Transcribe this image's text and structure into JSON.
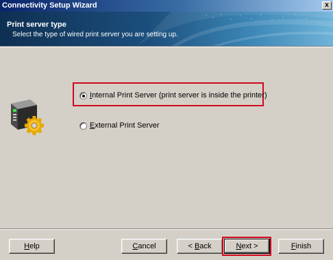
{
  "window": {
    "title": "Connectivity Setup Wizard",
    "close_glyph": "x"
  },
  "header": {
    "title": "Print server type",
    "subtitle": "Select the type of wired print server you are setting up."
  },
  "options": [
    {
      "label_pre": "I",
      "label_rest": "nternal Print Server (print server is inside the printer)",
      "selected": true
    },
    {
      "label_pre": "E",
      "label_rest": "xternal Print Server",
      "selected": false
    }
  ],
  "buttons": {
    "help": {
      "pre": "",
      "key": "H",
      "rest": "elp"
    },
    "cancel": {
      "pre": "",
      "key": "C",
      "rest": "ancel"
    },
    "back": {
      "pre": "< ",
      "key": "B",
      "rest": "ack"
    },
    "next": {
      "pre": "",
      "key": "N",
      "rest": "ext >"
    },
    "finish": {
      "pre": "",
      "key": "F",
      "rest": "inish"
    }
  },
  "colors": {
    "highlight": "#d0081c",
    "banner": "#1c4f7d",
    "background": "#d4d0c8"
  },
  "icons": {
    "device": "print-server-gear-icon"
  }
}
